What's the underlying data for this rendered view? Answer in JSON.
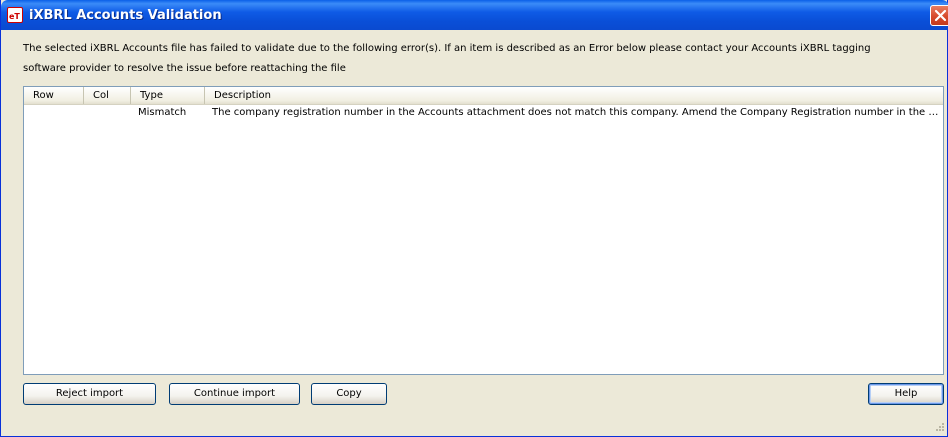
{
  "window": {
    "title": "iXBRL Accounts Validation",
    "icon": "app-icon",
    "colors": {
      "titlebar": "#0a4fd8",
      "close": "#d74a2c",
      "background": "#ece9d8"
    }
  },
  "message": {
    "line1": "The selected iXBRL Accounts file has failed to validate due to the following error(s). If an item is described as an Error below please contact your Accounts iXBRL tagging",
    "line2": "software provider to resolve the issue before reattaching the file"
  },
  "table": {
    "columns": [
      "Row",
      "Col",
      "Type",
      "Description"
    ],
    "rows": [
      {
        "row": "",
        "col": "",
        "type": "Mismatch",
        "description": "The company registration number in the Accounts attachment does not match this company. Amend the Company Registration number in the Stan..."
      }
    ]
  },
  "buttons": {
    "reject": "Reject import",
    "continue": "Continue import",
    "copy": "Copy",
    "help": "Help"
  }
}
